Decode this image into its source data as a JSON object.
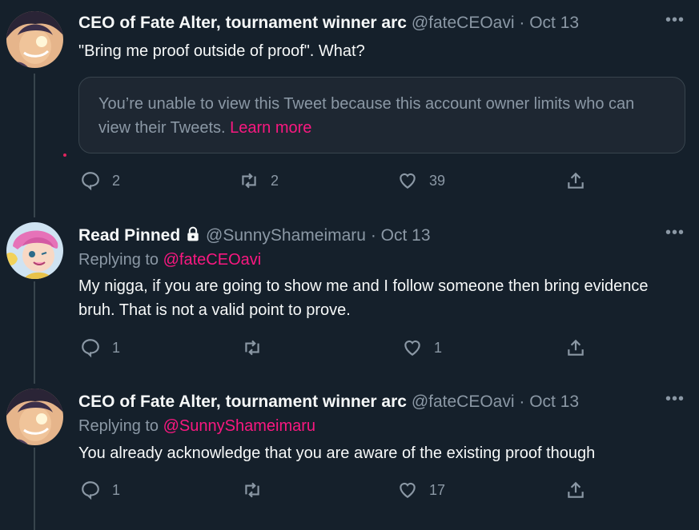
{
  "tweets": [
    {
      "name": "CEO of Fate Alter, tournament winner arc",
      "handle": "@fateCEOavi",
      "date": "Oct 13",
      "text": "\"Bring me proof outside of proof\". What?",
      "quote_notice": "You’re unable to view this Tweet because this account owner limits who can view their Tweets.",
      "quote_link": "Learn more",
      "replies": "2",
      "retweets": "2",
      "likes": "39"
    },
    {
      "name": "Read Pinned",
      "handle": "@SunnyShameimaru",
      "date": "Oct 13",
      "reply_prefix": "Replying to",
      "reply_to": "@fateCEOavi",
      "text": "My nigga, if you are going to show me and I follow someone then bring evidence bruh. That is not a valid point to prove.",
      "replies": "1",
      "retweets": "",
      "likes": "1"
    },
    {
      "name": "CEO of Fate Alter, tournament winner arc",
      "handle": "@fateCEOavi",
      "date": "Oct 13",
      "reply_prefix": "Replying to",
      "reply_to": "@SunnyShameimaru",
      "text": "You already acknowledge that you are aware of the existing proof though",
      "replies": "1",
      "retweets": "",
      "likes": "17"
    }
  ],
  "separator": "·",
  "more_icon": "more-dots-icon",
  "colors": {
    "background": "#15202b",
    "accent": "#f91880",
    "muted": "#8b98a5",
    "line": "#38444d"
  }
}
